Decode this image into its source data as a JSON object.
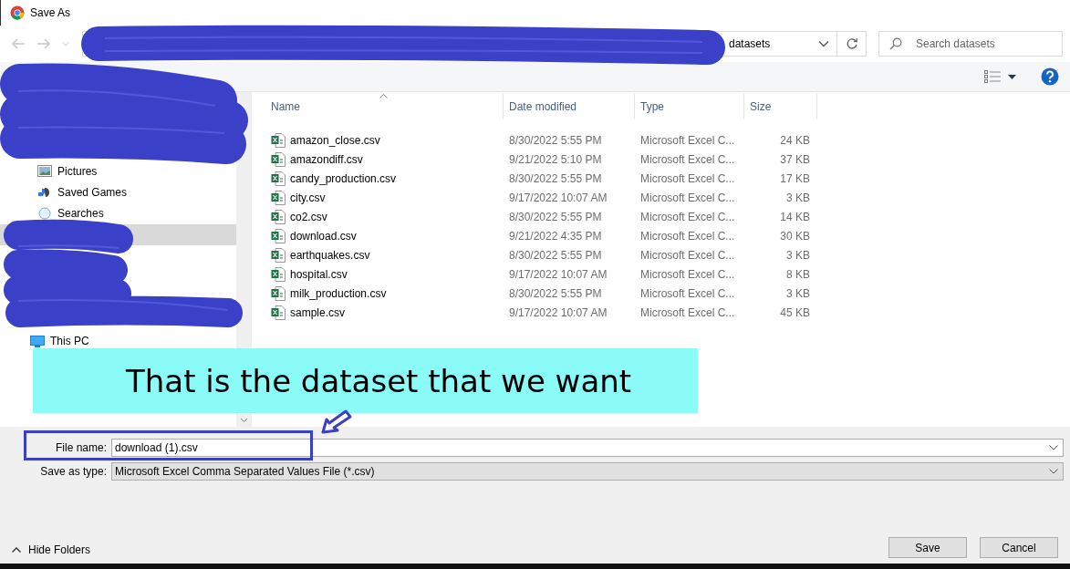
{
  "window": {
    "title": "Save As"
  },
  "address_bar": {
    "path": "datasets"
  },
  "search": {
    "placeholder": "Search datasets"
  },
  "sidebar": {
    "items": [
      {
        "label": "Pictures",
        "kind": "pictures"
      },
      {
        "label": "Saved Games",
        "kind": "games"
      },
      {
        "label": "Searches",
        "kind": "searches"
      },
      {
        "label": "This PC",
        "kind": "pc"
      }
    ]
  },
  "file_list": {
    "columns": [
      "Name",
      "Date modified",
      "Type",
      "Size"
    ],
    "rows": [
      {
        "name": "amazon_close.csv",
        "date_modified": "8/30/2022 5:55 PM",
        "type": "Microsoft Excel C...",
        "size": "24 KB"
      },
      {
        "name": "amazondiff.csv",
        "date_modified": "9/21/2022 5:10 PM",
        "type": "Microsoft Excel C...",
        "size": "37 KB"
      },
      {
        "name": "candy_production.csv",
        "date_modified": "8/30/2022 5:55 PM",
        "type": "Microsoft Excel C...",
        "size": "17 KB"
      },
      {
        "name": "city.csv",
        "date_modified": "9/17/2022 10:07 AM",
        "type": "Microsoft Excel C...",
        "size": "3 KB"
      },
      {
        "name": "co2.csv",
        "date_modified": "8/30/2022 5:55 PM",
        "type": "Microsoft Excel C...",
        "size": "14 KB"
      },
      {
        "name": "download.csv",
        "date_modified": "9/21/2022 4:35 PM",
        "type": "Microsoft Excel C...",
        "size": "30 KB"
      },
      {
        "name": "earthquakes.csv",
        "date_modified": "8/30/2022 5:55 PM",
        "type": "Microsoft Excel C...",
        "size": "3 KB"
      },
      {
        "name": "hospital.csv",
        "date_modified": "9/17/2022 10:07 AM",
        "type": "Microsoft Excel C...",
        "size": "8 KB"
      },
      {
        "name": "milk_production.csv",
        "date_modified": "8/30/2022 5:55 PM",
        "type": "Microsoft Excel C...",
        "size": "3 KB"
      },
      {
        "name": "sample.csv",
        "date_modified": "9/17/2022 10:07 AM",
        "type": "Microsoft Excel C...",
        "size": "45 KB"
      }
    ]
  },
  "form": {
    "file_name_label": "File name:",
    "file_name": "download (1).csv",
    "save_type_label": "Save as type:",
    "save_type": "Microsoft Excel Comma Separated Values File (*.csv)"
  },
  "hide_folders": "Hide Folders",
  "buttons": [
    "Save",
    "Cancel"
  ],
  "annotation": {
    "text": "That is the dataset that we want"
  }
}
